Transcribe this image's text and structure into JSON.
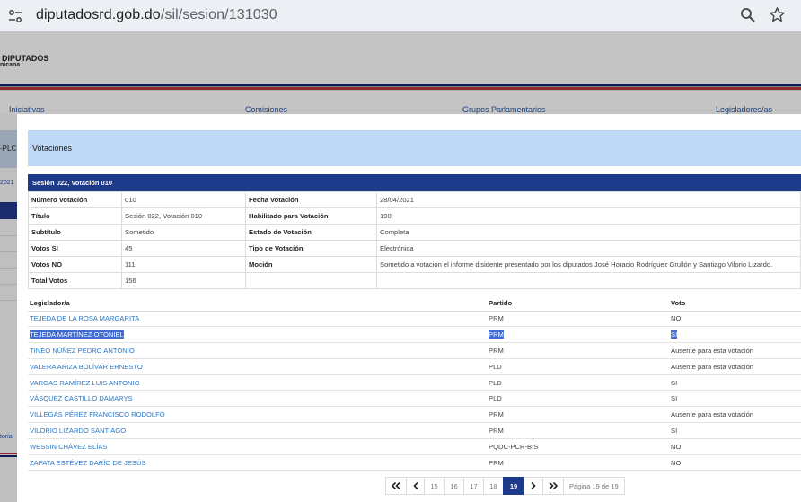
{
  "browser": {
    "url_host": "diputadosrd.gob.do",
    "url_path": "/sil/sesion/131030"
  },
  "site": {
    "logo_line1": "DIPUTADOS",
    "logo_line2": "nicana",
    "nav": [
      "Iniciativas",
      "Comisiones",
      "Grupos Parlamentarios",
      "Legisladores/as"
    ],
    "left_fragments": [
      "-PLC",
      "2021",
      "torial"
    ]
  },
  "modal": {
    "title": "Votaciones",
    "session_header": "Sesión 022, Votación 010",
    "info_rows": [
      {
        "l1": "Número Votación",
        "v1": "010",
        "l2": "Fecha Votación",
        "v2": "28/04/2021"
      },
      {
        "l1": "Título",
        "v1": "Sesión 022, Votación 010",
        "l2": "Habilitado para Votación",
        "v2": "190"
      },
      {
        "l1": "Subtítulo",
        "v1": "Sometido",
        "l2": "Estado de Votación",
        "v2": "Completa"
      },
      {
        "l1": "Votos SI",
        "v1": "45",
        "l2": "Tipo de Votación",
        "v2": "Electrónica"
      },
      {
        "l1": "Votos NO",
        "v1": "111",
        "l2": "Moción",
        "v2": "Sometido a votación el informe disidente presentado por los diputados José Horacio Rodríguez Grullón y Santiago Vilorio Lizardo."
      },
      {
        "l1": "Total Votos",
        "v1": "156",
        "l2": "",
        "v2": ""
      }
    ],
    "votes_headers": [
      "Legislador/a",
      "Partido",
      "Voto"
    ],
    "votes": [
      {
        "name": "TEJEDA DE LA ROSA MARGARITA",
        "party": "PRM",
        "vote": "NO"
      },
      {
        "name": "TEJEDA MARTÍNEZ OTONIEL",
        "party": "PRM",
        "vote": "SI"
      },
      {
        "name": "TINEO NÚÑEZ PEDRO ANTONIO",
        "party": "PRM",
        "vote": "Ausente para esta votación"
      },
      {
        "name": "VALERA ARIZA BOLÍVAR ERNESTO",
        "party": "PLD",
        "vote": "Ausente para esta votación"
      },
      {
        "name": "VARGAS RAMÍREZ LUIS ANTONIO",
        "party": "PLD",
        "vote": "SI"
      },
      {
        "name": "VÁSQUEZ CASTILLO DAMARYS",
        "party": "PLD",
        "vote": "SI"
      },
      {
        "name": "VILLEGAS PÉREZ FRANCISCO RODOLFO",
        "party": "PRM",
        "vote": "Ausente para esta votación"
      },
      {
        "name": "VILORIO LIZARDO SANTIAGO",
        "party": "PRM",
        "vote": "SI"
      },
      {
        "name": "WESSIN CHÁVEZ ELÍAS",
        "party": "PQDC-PCR-BIS",
        "vote": "NO"
      },
      {
        "name": "ZAPATA ESTÉVEZ DARÍO DE JESÚS",
        "party": "PRM",
        "vote": "NO"
      }
    ],
    "pagination": {
      "pages": [
        "15",
        "16",
        "17",
        "18",
        "19"
      ],
      "current": "19",
      "info": "Página 19 de 19"
    }
  },
  "colors": {
    "header_blue": "#1e3a8a",
    "title_bar": "#bfd8f5",
    "link": "#2a78c5",
    "selection": "#3f6bd2"
  }
}
